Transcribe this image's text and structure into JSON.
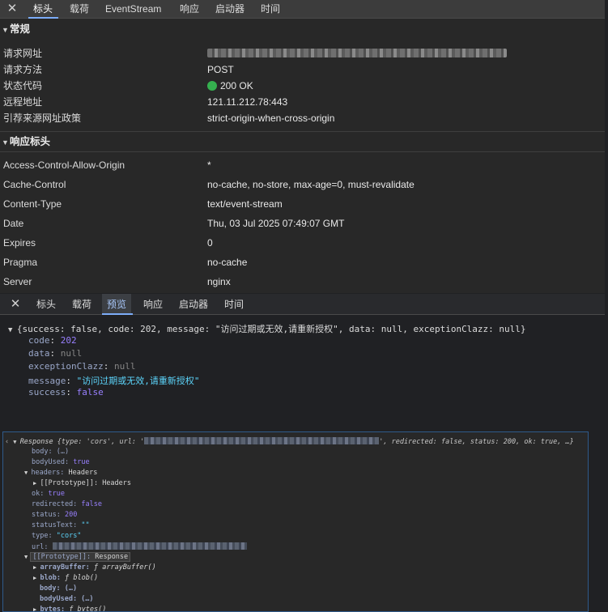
{
  "headers_panel": {
    "close": "✕",
    "tabs": [
      "标头",
      "载荷",
      "EventStream",
      "响应",
      "启动器",
      "时间"
    ],
    "active_tab": "标头",
    "general": {
      "title": "常规",
      "request_url_label": "请求网址",
      "request_method_label": "请求方法",
      "request_method": "POST",
      "status_code_label": "状态代码",
      "status_code": "200 OK",
      "remote_address_label": "远程地址",
      "remote_address": "121.11.212.78:443",
      "referrer_policy_label": "引荐来源网址政策",
      "referrer_policy": "strict-origin-when-cross-origin"
    },
    "response_headers": {
      "title": "响应标头",
      "rows": [
        {
          "name": "Access-Control-Allow-Origin",
          "value": "*"
        },
        {
          "name": "Cache-Control",
          "value": "no-cache, no-store, max-age=0, must-revalidate"
        },
        {
          "name": "Content-Type",
          "value": "text/event-stream"
        },
        {
          "name": "Date",
          "value": "Thu, 03 Jul 2025 07:49:07 GMT"
        },
        {
          "name": "Expires",
          "value": "0"
        },
        {
          "name": "Pragma",
          "value": "no-cache"
        },
        {
          "name": "Server",
          "value": "nginx"
        }
      ]
    }
  },
  "preview_panel": {
    "close": "✕",
    "tabs": [
      "标头",
      "载荷",
      "预览",
      "响应",
      "启动器",
      "时间"
    ],
    "active_tab": "预览",
    "summary": "{success: false, code: 202, message: \"访问过期或无效,请重新授权\", data: null, exceptionClazz: null}",
    "code_key": "code",
    "code_val": "202",
    "data_key": "data",
    "data_val": "null",
    "exc_key": "exceptionClazz",
    "exc_val": "null",
    "msg_key": "message",
    "msg_val": "\"访问过期或无效,请重新授权\"",
    "succ_key": "success",
    "succ_val": "false"
  },
  "console_panel": {
    "head_name": "Response",
    "head_a": "{type: 'cors', url: '",
    "head_b": "', redirected: false, status: 200, ok: true, …}",
    "lines": {
      "body": "body: (…)",
      "bodyUsed_k": "bodyUsed:",
      "bodyUsed_v": "true",
      "headers_k": "headers:",
      "headers_v": "Headers",
      "proto1": "[[Prototype]]: Headers",
      "ok_k": "ok:",
      "ok_v": "true",
      "redirected_k": "redirected:",
      "redirected_v": "false",
      "status_k": "status:",
      "status_v": "200",
      "statusText_k": "statusText:",
      "statusText_v": "\"\"",
      "type_k": "type:",
      "type_v": "\"cors\"",
      "url_k": "url:",
      "proto2_k": "[[Prototype]]:",
      "proto2_v": "Response",
      "ab_k": "arrayBuffer:",
      "ab_v": "ƒ arrayBuffer()",
      "blob_k": "blob:",
      "blob_v": "ƒ blob()",
      "body2": "body: (…)",
      "bodyUsed2": "bodyUsed: (…)",
      "bytes_k": "bytes:",
      "bytes_v": "ƒ bytes()"
    }
  }
}
